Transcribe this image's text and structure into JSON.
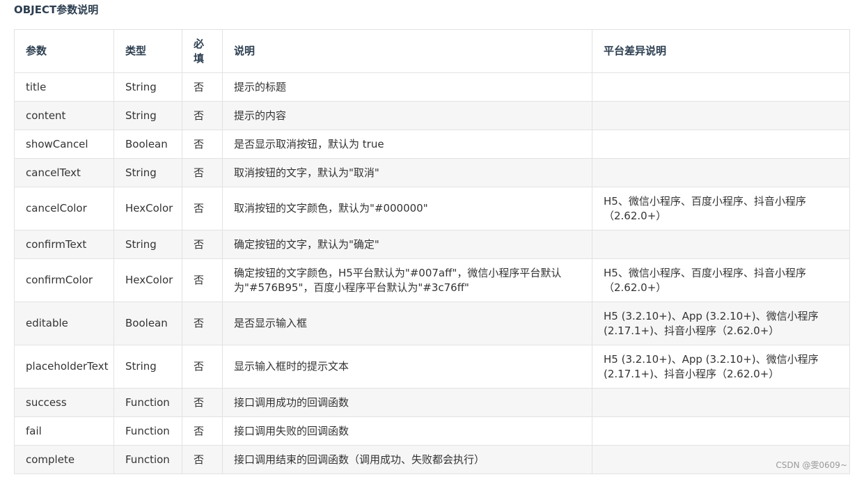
{
  "heading": "OBJECT参数说明",
  "table": {
    "headers": {
      "param": "参数",
      "type": "类型",
      "required": "必填",
      "description": "说明",
      "platform": "平台差异说明"
    },
    "rows": [
      {
        "param": "title",
        "type": "String",
        "required": "否",
        "description": "提示的标题",
        "platform": ""
      },
      {
        "param": "content",
        "type": "String",
        "required": "否",
        "description": "提示的内容",
        "platform": ""
      },
      {
        "param": "showCancel",
        "type": "Boolean",
        "required": "否",
        "description": "是否显示取消按钮，默认为 true",
        "platform": ""
      },
      {
        "param": "cancelText",
        "type": "String",
        "required": "否",
        "description": "取消按钮的文字，默认为\"取消\"",
        "platform": ""
      },
      {
        "param": "cancelColor",
        "type": "HexColor",
        "required": "否",
        "description": "取消按钮的文字颜色，默认为\"#000000\"",
        "platform": "H5、微信小程序、百度小程序、抖音小程序（2.62.0+）"
      },
      {
        "param": "confirmText",
        "type": "String",
        "required": "否",
        "description": "确定按钮的文字，默认为\"确定\"",
        "platform": ""
      },
      {
        "param": "confirmColor",
        "type": "HexColor",
        "required": "否",
        "description": "确定按钮的文字颜色，H5平台默认为\"#007aff\"，微信小程序平台默认为\"#576B95\"，百度小程序平台默认为\"#3c76ff\"",
        "platform": "H5、微信小程序、百度小程序、抖音小程序（2.62.0+）"
      },
      {
        "param": "editable",
        "type": "Boolean",
        "required": "否",
        "description": "是否显示输入框",
        "platform": "H5 (3.2.10+)、App (3.2.10+)、微信小程序 (2.17.1+)、抖音小程序（2.62.0+）"
      },
      {
        "param": "placeholderText",
        "type": "String",
        "required": "否",
        "description": "显示输入框时的提示文本",
        "platform": "H5 (3.2.10+)、App (3.2.10+)、微信小程序 (2.17.1+)、抖音小程序（2.62.0+）"
      },
      {
        "param": "success",
        "type": "Function",
        "required": "否",
        "description": "接口调用成功的回调函数",
        "platform": ""
      },
      {
        "param": "fail",
        "type": "Function",
        "required": "否",
        "description": "接口调用失败的回调函数",
        "platform": ""
      },
      {
        "param": "complete",
        "type": "Function",
        "required": "否",
        "description": "接口调用结束的回调函数（调用成功、失败都会执行）",
        "platform": ""
      }
    ]
  },
  "watermark": "CSDN @雯0609~"
}
